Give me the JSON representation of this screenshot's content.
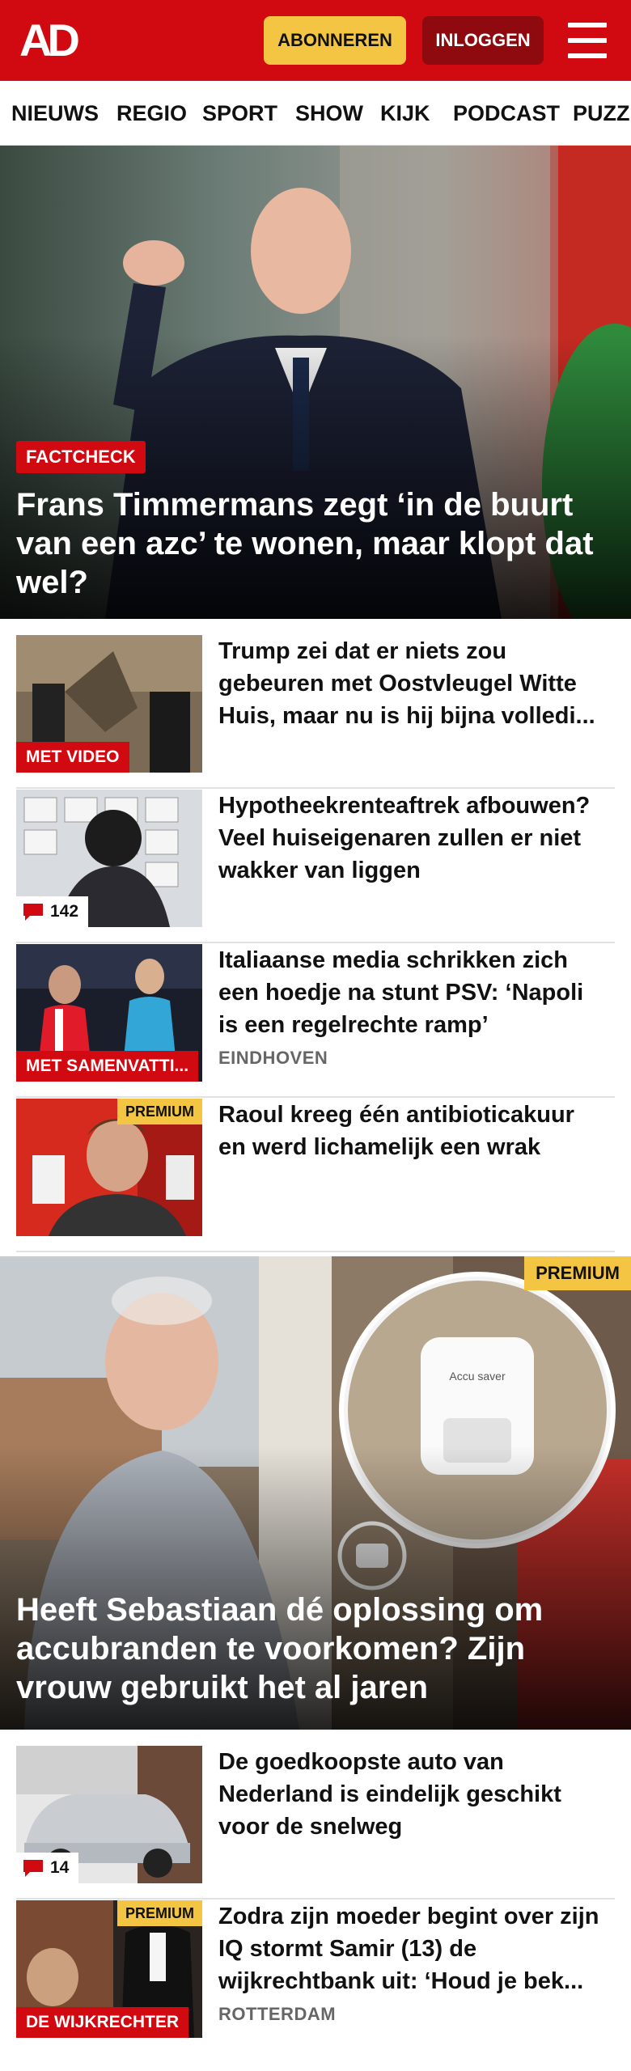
{
  "header": {
    "logo": "AD",
    "subscribe_label": "ABONNEREN",
    "login_label": "INLOGGEN",
    "brand_color": "#d10a11",
    "subscribe_color": "#f4c542"
  },
  "nav": {
    "items": [
      "NIEUWS",
      "REGIO",
      "SPORT",
      "SHOW",
      "KIJK",
      "PODCAST",
      "PUZZ"
    ]
  },
  "hero1": {
    "tag": "FACTCHECK",
    "title": "Frans Timmermans zegt ‘in de buurt van een azc’ te wonen, maar klopt dat wel?"
  },
  "articles1": [
    {
      "title": "Trump zei dat er niets zou gebeuren met Oostvleugel Witte Huis, maar nu is hij bijna volledi...",
      "tag": "MET VIDEO"
    },
    {
      "title": "Hypotheekrenteaftrek afbouwen? Veel huiseigenaren zullen er niet wakker van liggen",
      "comments": "142"
    },
    {
      "title": "Italiaanse media schrikken zich een hoedje na stunt PSV: ‘Napoli is een regelrechte ramp’",
      "tag": "MET SAMENVATTI...",
      "location": "EINDHOVEN"
    },
    {
      "title": "Raoul kreeg één antibioticakuur en werd lichamelijk een wrak",
      "premium": "PREMIUM"
    }
  ],
  "hero2": {
    "premium": "PREMIUM",
    "title": "Heeft Sebastiaan dé oplossing om accubranden te voorkomen? Zijn vrouw gebruikt het al jaren",
    "product_label": "Accu saver"
  },
  "articles2": [
    {
      "title": "De goedkoopste auto van Nederland is eindelijk geschikt voor de snelweg",
      "comments": "14"
    },
    {
      "title": "Zodra zijn moeder begint over zijn IQ stormt Samir (13) de wijkrechtbank uit: ‘Houd je bek...",
      "premium": "PREMIUM",
      "tag": "DE WIJKRECHTER",
      "location": "ROTTERDAM"
    }
  ]
}
